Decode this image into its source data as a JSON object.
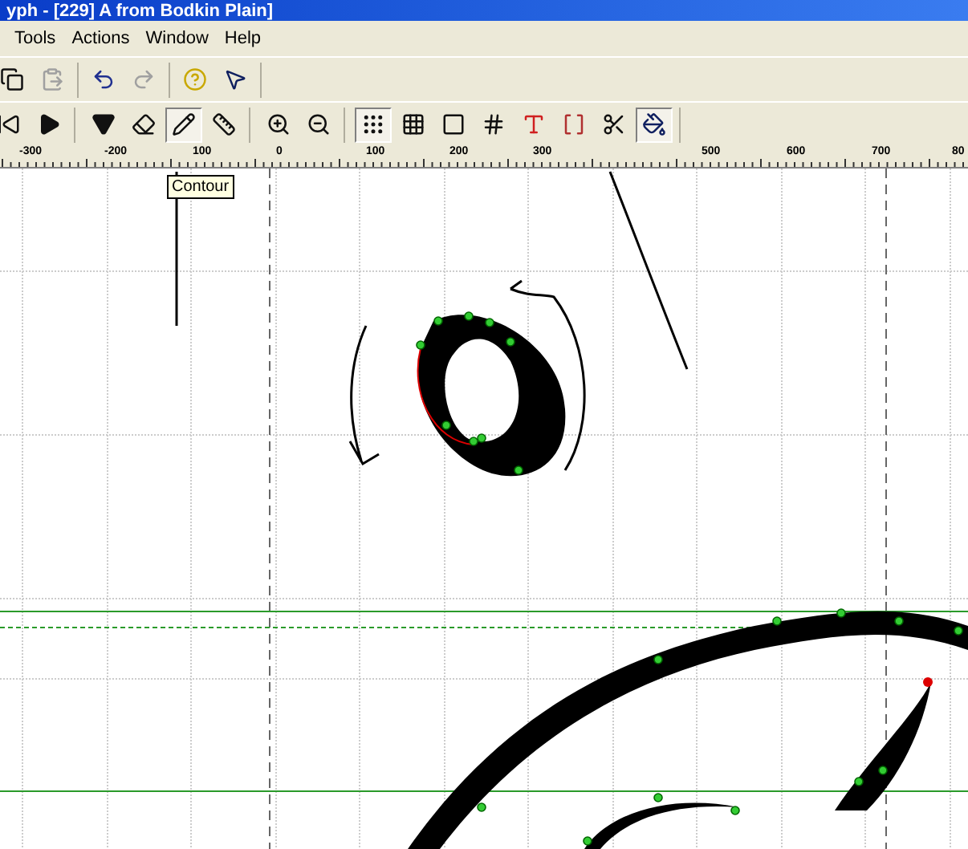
{
  "window": {
    "title": "yph - [229] A from Bodkin Plain]"
  },
  "menu": [
    {
      "label": "Tools"
    },
    {
      "label": "Actions"
    },
    {
      "label": "Window"
    },
    {
      "label": "Help"
    }
  ],
  "toolbar_1": [
    [
      {
        "kind": "copy",
        "disabled": false
      },
      {
        "kind": "paste",
        "disabled": true
      }
    ],
    [
      {
        "kind": "undo",
        "disabled": false
      },
      {
        "kind": "redo",
        "disabled": true
      }
    ],
    [
      {
        "kind": "help",
        "disabled": false
      },
      {
        "kind": "context-help",
        "disabled": false
      }
    ]
  ],
  "toolbar_2": [
    [
      {
        "kind": "previous",
        "selected": false
      },
      {
        "kind": "next",
        "selected": false
      }
    ],
    [
      {
        "kind": "select",
        "selected": false
      },
      {
        "kind": "eraser",
        "selected": false
      },
      {
        "kind": "pencil",
        "selected": true
      },
      {
        "kind": "ruler",
        "selected": false
      }
    ],
    [
      {
        "kind": "zoom-in",
        "selected": false
      },
      {
        "kind": "zoom-out",
        "selected": false
      }
    ],
    [
      {
        "kind": "points",
        "selected": true
      },
      {
        "kind": "grid",
        "selected": false
      },
      {
        "kind": "frame",
        "selected": false
      },
      {
        "kind": "grid-dense",
        "selected": false
      },
      {
        "kind": "letter",
        "selected": false
      },
      {
        "kind": "bracket",
        "selected": false
      },
      {
        "kind": "scissors",
        "selected": false
      },
      {
        "kind": "fill",
        "selected": true
      }
    ]
  ],
  "ruler": {
    "labels": [
      "-300",
      "-200",
      "100",
      "0",
      "100",
      "200",
      "300",
      "500",
      "600",
      "700",
      "80"
    ]
  },
  "tooltip": {
    "text": "Contour"
  }
}
